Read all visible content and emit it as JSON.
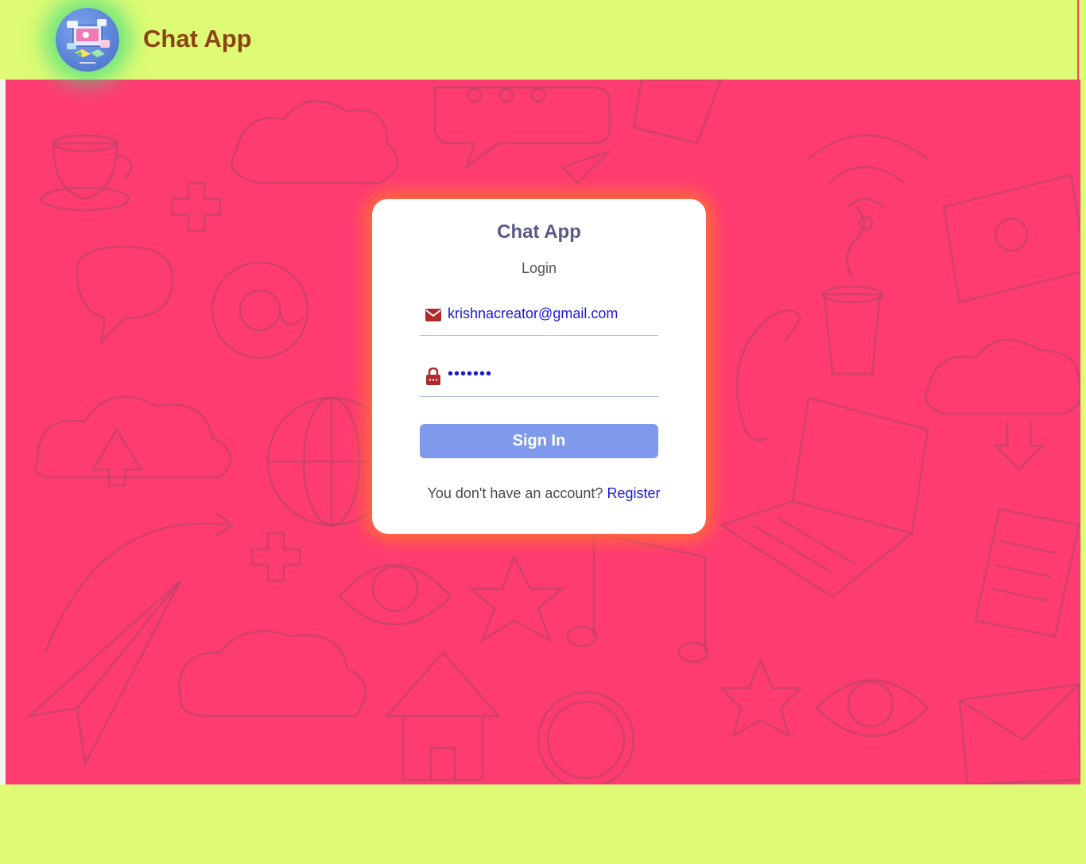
{
  "header": {
    "brand": "Chat App"
  },
  "login_card": {
    "title": "Chat App",
    "subtitle": "Login",
    "email_value": "krishnacreator@gmail.com",
    "password_value": "•••••••",
    "signin_label": "Sign In",
    "no_account_text": "You don't have an account?",
    "register_label": "Register"
  },
  "icons": {
    "email": "mail-icon",
    "password": "lock-icon",
    "logo": "chat-app-logo"
  },
  "colors": {
    "header_bg": "#dffb75",
    "brand_text": "#8b4513",
    "hero_bg": "#ff3c72",
    "card_glow": "#ff7828",
    "button_bg": "#7f9aec",
    "input_text": "#1a19d6",
    "icon_color": "#b02a2a"
  }
}
